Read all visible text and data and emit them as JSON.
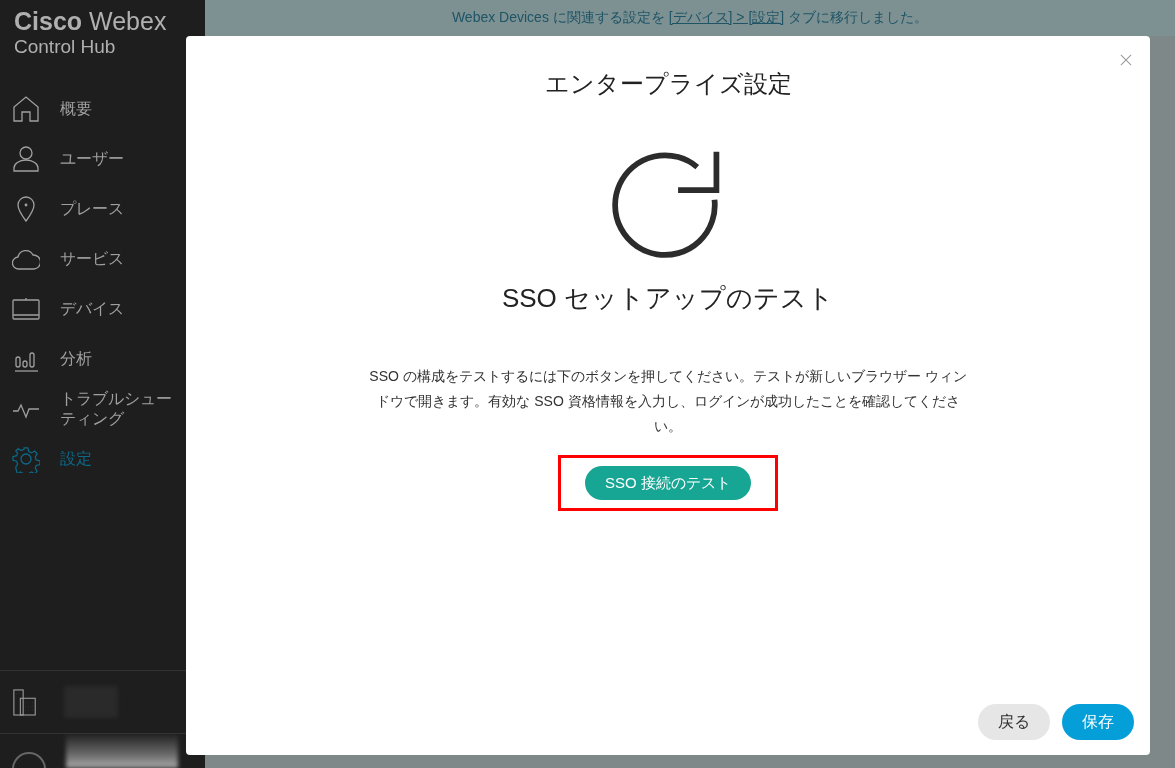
{
  "sidebar": {
    "logo": {
      "brand": "Cisco",
      "product": "Webex",
      "subtitle": "Control Hub"
    },
    "items": [
      {
        "label": "概要",
        "selected": false
      },
      {
        "label": "ユーザー",
        "selected": false
      },
      {
        "label": "プレース",
        "selected": false
      },
      {
        "label": "サービス",
        "selected": false
      },
      {
        "label": "デバイス",
        "selected": false
      },
      {
        "label": "分析",
        "selected": false
      },
      {
        "label": "トラブルシューティング",
        "selected": false
      },
      {
        "label": "設定",
        "selected": true
      }
    ]
  },
  "banner": {
    "text_before": "Webex Devices に関連する設定を ",
    "link": "[デバイス] > [設定]",
    "text_after": " タブに移行しました。"
  },
  "dialog": {
    "title": "エンタープライズ設定",
    "heading": "SSO セットアップのテスト",
    "description": "SSO の構成をテストするには下のボタンを押してください。テストが新しいブラウザー ウィンドウで開きます。有効な SSO 資格情報を入力し、ログインが成功したことを確認してください。",
    "test_button": "SSO 接続のテスト",
    "highlighted": true,
    "buttons": [
      {
        "label": "戻る",
        "kind": "secondary"
      },
      {
        "label": "保存",
        "kind": "primary"
      }
    ]
  }
}
